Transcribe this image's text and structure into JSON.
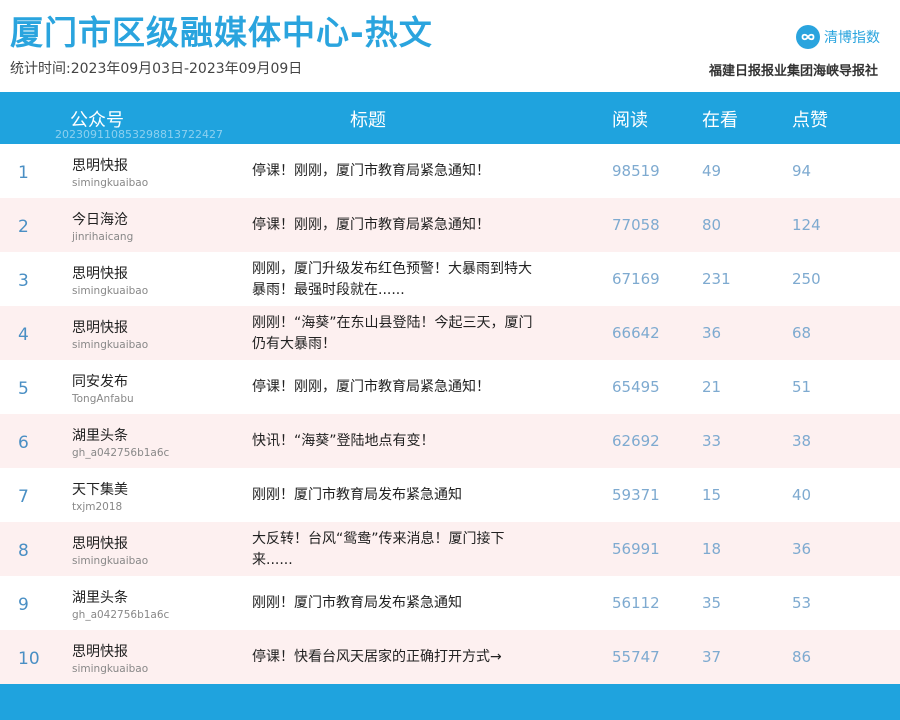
{
  "header": {
    "title": "厦门市区级融媒体中心-热文",
    "period": "统计时间:2023年09月03日-2023年09月09日",
    "brand_name": "清博指数",
    "publisher": "福建日报报业集团海峡导报社"
  },
  "table": {
    "columns": {
      "account": "公众号",
      "title": "标题",
      "reads": "阅读",
      "views": "在看",
      "likes": "点赞"
    },
    "header_id": "20230911085329881372242​7",
    "rows": [
      {
        "rank": "1",
        "account": "思明快报",
        "account_id": "simingkuaibao",
        "title": "停课！刚刚，厦门市教育局紧急通知！",
        "reads": "98519",
        "views": "49",
        "likes": "94"
      },
      {
        "rank": "2",
        "account": "今日海沧",
        "account_id": "jinrihaicang",
        "title": "停课！刚刚，厦门市教育局紧急通知！",
        "reads": "77058",
        "views": "80",
        "likes": "124"
      },
      {
        "rank": "3",
        "account": "思明快报",
        "account_id": "simingkuaibao",
        "title": "刚刚，厦门升级发布红色预警！大暴雨到特大暴雨！最强时段就在......",
        "reads": "67169",
        "views": "231",
        "likes": "250"
      },
      {
        "rank": "4",
        "account": "思明快报",
        "account_id": "simingkuaibao",
        "title": "刚刚！“海葵”在东山县登陆！今起三天，厦门仍有大暴雨！",
        "reads": "66642",
        "views": "36",
        "likes": "68"
      },
      {
        "rank": "5",
        "account": "同安发布",
        "account_id": "TongAnfabu",
        "title": "停课！刚刚，厦门市教育局紧急通知！",
        "reads": "65495",
        "views": "21",
        "likes": "51"
      },
      {
        "rank": "6",
        "account": "湖里头条",
        "account_id": "gh_a042756b1a6c",
        "title": "快讯！“海葵”登陆地点有变！",
        "reads": "62692",
        "views": "33",
        "likes": "38"
      },
      {
        "rank": "7",
        "account": "天下集美",
        "account_id": "txjm2018",
        "title": "刚刚！厦门市教育局发布紧急通知",
        "reads": "59371",
        "views": "15",
        "likes": "40"
      },
      {
        "rank": "8",
        "account": "思明快报",
        "account_id": "simingkuaibao",
        "title": "大反转！台风“鸳鸯”传来消息！厦门接下来......",
        "reads": "56991",
        "views": "18",
        "likes": "36"
      },
      {
        "rank": "9",
        "account": "湖里头条",
        "account_id": "gh_a042756b1a6c",
        "title": "刚刚！厦门市教育局发布紧急通知",
        "reads": "56112",
        "views": "35",
        "likes": "53"
      },
      {
        "rank": "10",
        "account": "思明快报",
        "account_id": "simingkuaibao",
        "title": "停课！快看台风天居家的正确打开方式→",
        "reads": "55747",
        "views": "37",
        "likes": "86"
      }
    ]
  },
  "colors": {
    "accent": "#1FA3DE",
    "title_blue": "#2AA4DE",
    "stripe": "#FDF0F0",
    "number": "#7EAAD0"
  },
  "icons": {
    "brand": "infinity-logo-icon"
  }
}
